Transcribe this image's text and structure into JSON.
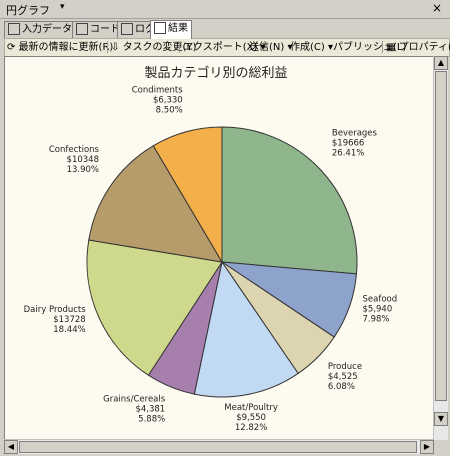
{
  "window": {
    "title": "円グラフ",
    "dropdown_glyph": "▾",
    "close_glyph": "×"
  },
  "tabs": [
    {
      "label": "入力データ",
      "icon": "table-icon"
    },
    {
      "label": "コード",
      "icon": "code-icon"
    },
    {
      "label": "ログ",
      "icon": "log-icon"
    },
    {
      "label": "結果",
      "icon": "result-icon",
      "active": true
    }
  ],
  "toolbar": {
    "refresh": "最新の情報に更新(R)",
    "change_task": "タスクの変更(Y)",
    "export": "エクスポート(X)",
    "send": "送信(N)",
    "create": "作成(C)",
    "publish": "パブリッシュ(L)",
    "properties": "プロパティ(I)"
  },
  "chart_data": {
    "type": "pie",
    "title": "製品カテゴリ別の総利益",
    "slices": [
      {
        "name": "Beverages",
        "amount": "$19666",
        "value": 19666,
        "percent": "26.41%",
        "color": "#8fb58d"
      },
      {
        "name": "Seafood",
        "amount": "$5,940",
        "value": 5940,
        "percent": "7.98%",
        "color": "#8ea3cc"
      },
      {
        "name": "Produce",
        "amount": "$4,525",
        "value": 4525,
        "percent": "6.08%",
        "color": "#ddd4b0"
      },
      {
        "name": "Meat/Poultry",
        "amount": "$9,550",
        "value": 9550,
        "percent": "12.82%",
        "color": "#c2d9f3"
      },
      {
        "name": "Grains/Cereals",
        "amount": "$4,381",
        "value": 4381,
        "percent": "5.88%",
        "color": "#a67fac"
      },
      {
        "name": "Dairy Products",
        "amount": "$13728",
        "value": 13728,
        "percent": "18.44%",
        "color": "#cfd98c"
      },
      {
        "name": "Confections",
        "amount": "$10348",
        "value": 10348,
        "percent": "13.90%",
        "color": "#b69c6a"
      },
      {
        "name": "Condiments",
        "amount": "$6,330",
        "value": 6330,
        "percent": "8.50%",
        "color": "#f2af4a"
      }
    ]
  }
}
